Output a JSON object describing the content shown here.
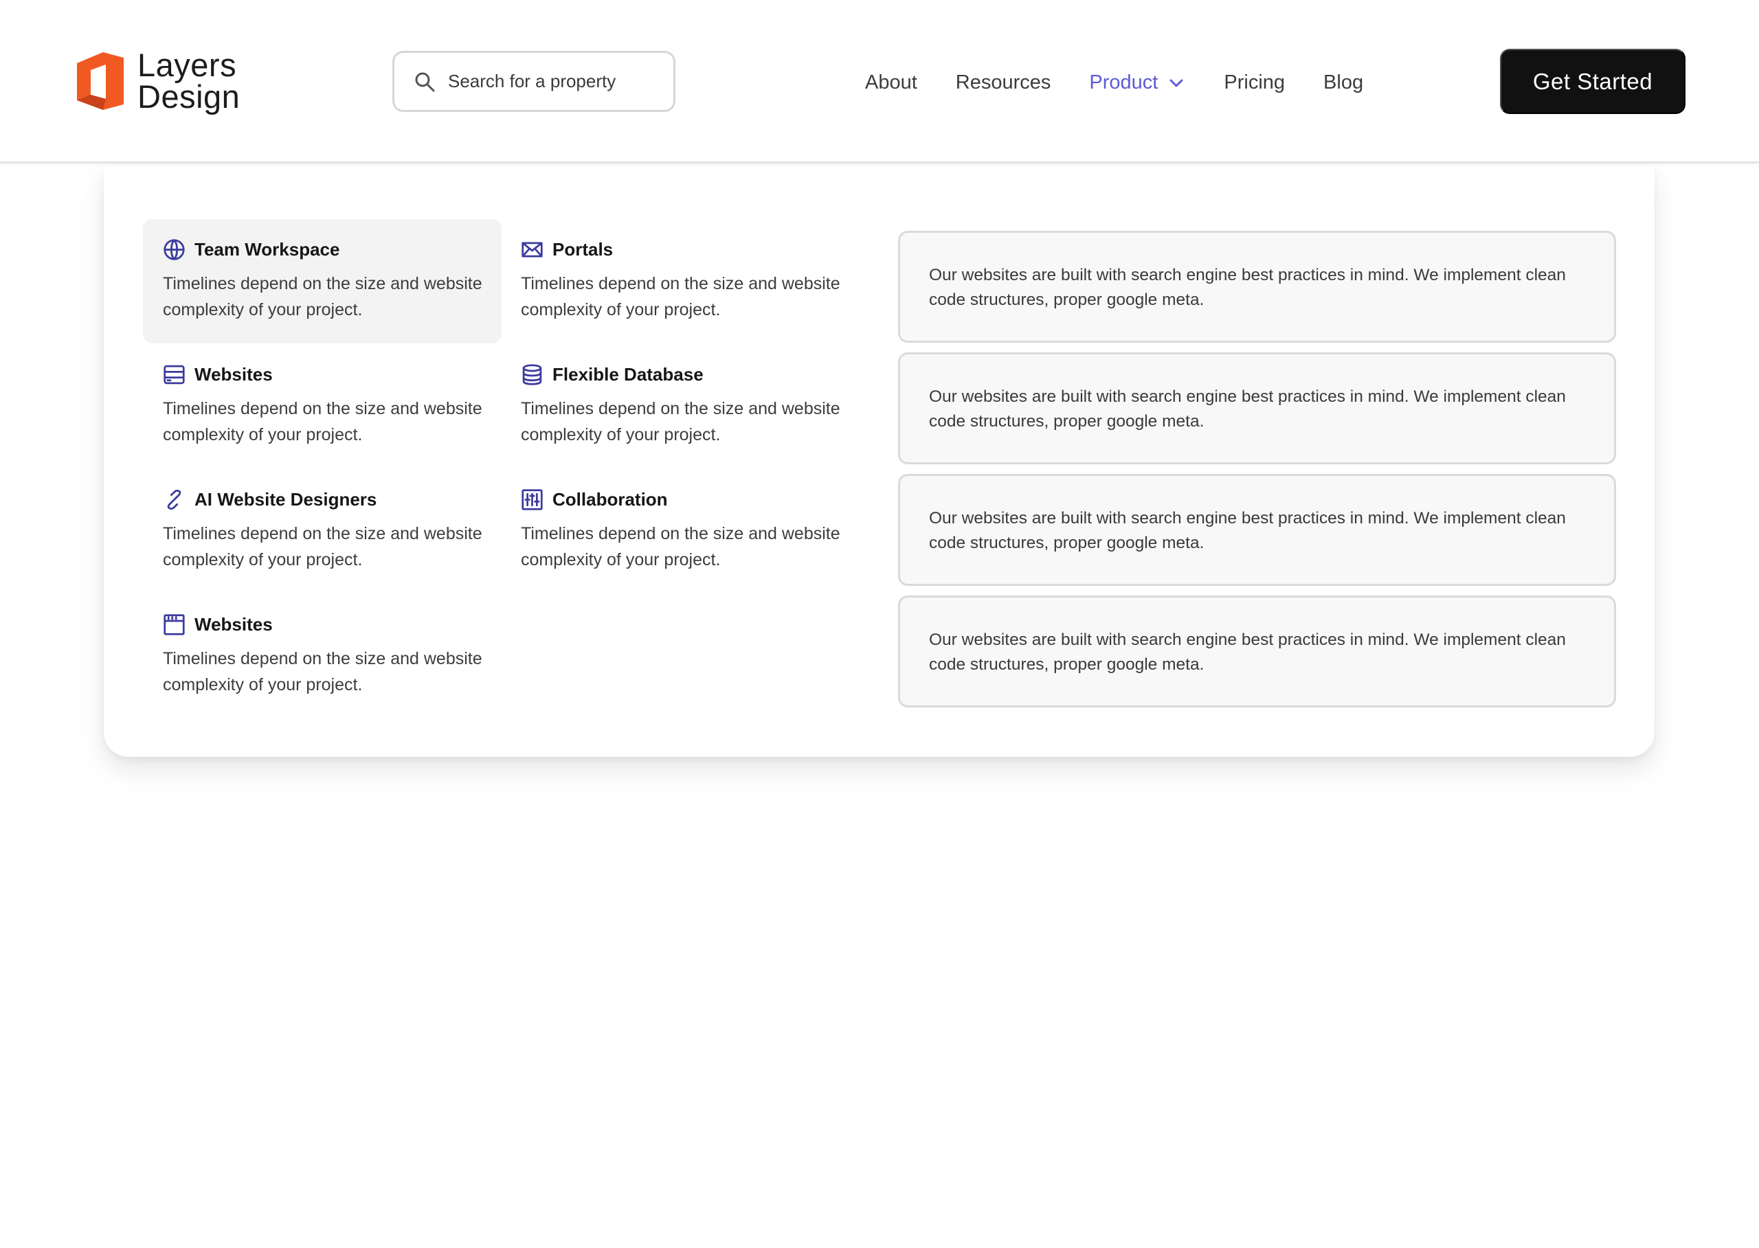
{
  "brand": {
    "name_line1": "Layers",
    "name_line2": "Design",
    "color": "#f05a22"
  },
  "search": {
    "placeholder": "Search for a property"
  },
  "nav": {
    "items": [
      {
        "label": "About"
      },
      {
        "label": "Resources"
      },
      {
        "label": "Product",
        "active": true,
        "icon": "chevron-down-icon"
      },
      {
        "label": "Pricing"
      },
      {
        "label": "Blog"
      }
    ],
    "active_color": "#5b5bd6"
  },
  "cta": {
    "label": "Get Started"
  },
  "dropdown": {
    "features": [
      {
        "title": "Team Workspace",
        "icon": "globe-icon",
        "description": "Timelines depend on the size and website complexity of your project.",
        "highlighted": true
      },
      {
        "title": "Portals",
        "icon": "mail-icon",
        "description": "Timelines depend on the size and website complexity of your project."
      },
      {
        "title": "Websites",
        "icon": "server-icon",
        "description": "Timelines depend on the size and website complexity of your project."
      },
      {
        "title": "Flexible Database",
        "icon": "database-icon",
        "description": "Timelines depend on the size and website complexity of your project."
      },
      {
        "title": "AI Website Designers",
        "icon": "link-icon",
        "description": "Timelines depend on the size and website complexity of your project."
      },
      {
        "title": "Collaboration",
        "icon": "sliders-icon",
        "description": "Timelines depend on the size and website complexity of your project."
      },
      {
        "title": "Websites",
        "icon": "browser-window-icon",
        "description": "Timelines depend on the size and website complexity of your project."
      }
    ],
    "cards": [
      {
        "text": "Our websites are built with search engine best practices in mind. We implement clean code structures, proper google meta."
      },
      {
        "text": "Our websites are built with search engine best practices in mind. We implement clean code structures, proper google meta."
      },
      {
        "text": "Our websites are built with search engine best practices in mind. We implement clean code structures, proper google meta."
      },
      {
        "text": "Our websites are built with search engine best practices in mind. We implement clean code structures, proper google meta."
      }
    ],
    "icon_color": "#3b3b9e"
  }
}
